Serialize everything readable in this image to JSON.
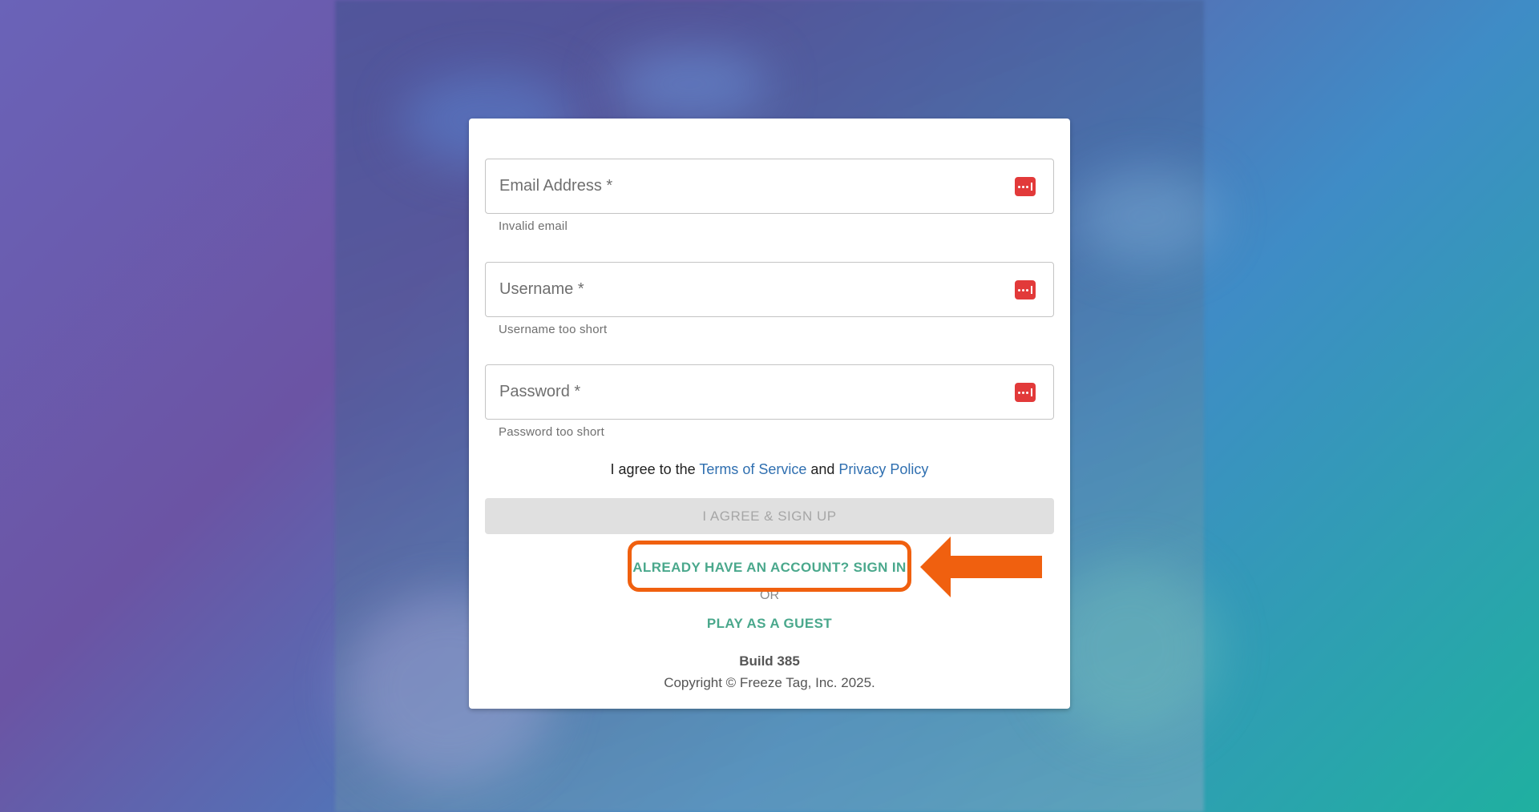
{
  "form": {
    "email": {
      "label": "Email Address *",
      "helper": "Invalid email"
    },
    "username": {
      "label": "Username *",
      "helper": "Username too short"
    },
    "password": {
      "label": "Password *",
      "helper": "Password too short"
    },
    "agree": {
      "prefix": "I agree to the ",
      "terms": "Terms of Service",
      "conjunction": " and ",
      "privacy": "Privacy Policy"
    },
    "signup_label": "I AGREE & SIGN UP",
    "signin_label": "ALREADY HAVE AN ACCOUNT? SIGN IN",
    "or_label": "OR",
    "guest_label": "PLAY AS A GUEST"
  },
  "footer": {
    "build": "Build 385",
    "copyright": "Copyright © Freeze Tag, Inc. 2025."
  },
  "icons": {
    "field_icon": "password-manager-icon",
    "annotation_arrow": "arrow-left-icon"
  },
  "colors": {
    "error_icon": "#e23a3a",
    "link_blue": "#2f6fb0",
    "link_green": "#4aa88c",
    "annotation": "#f0600f",
    "button_disabled": "#e0e0e0"
  }
}
